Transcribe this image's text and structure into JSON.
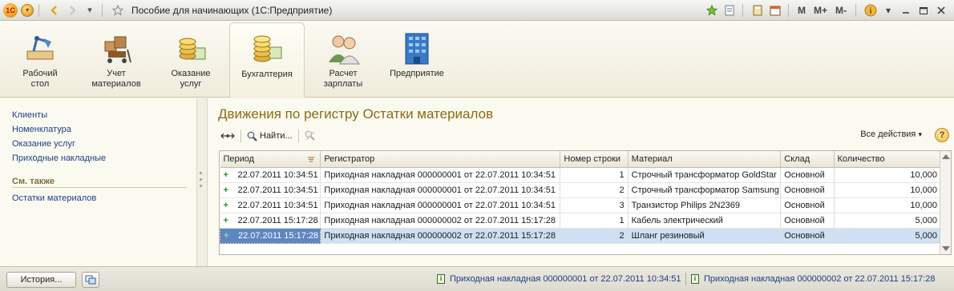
{
  "window": {
    "title": "Пособие для начинающих  (1С:Предприятие)",
    "logo": "1C",
    "right_buttons": [
      "M",
      "M+",
      "M-"
    ]
  },
  "sections": [
    {
      "label": "Рабочий\nстол",
      "icon": "desk-lamp-icon"
    },
    {
      "label": "Учет\nматериалов",
      "icon": "boxes-cart-icon"
    },
    {
      "label": "Оказание\nуслуг",
      "icon": "coins-icon"
    },
    {
      "label": "Бухгалтерия",
      "icon": "coins-stack-icon",
      "active": true
    },
    {
      "label": "Расчет\nзарплаты",
      "icon": "people-icon"
    },
    {
      "label": "Предприятие",
      "icon": "building-icon"
    }
  ],
  "left_nav": {
    "links": [
      "Клиенты",
      "Номенклатура",
      "Оказание услуг",
      "Приходные накладные"
    ],
    "see_also_title": "См. также",
    "see_also": [
      "Остатки материалов"
    ]
  },
  "form": {
    "title": "Движения по регистру Остатки материалов",
    "toolbar": {
      "find_label": "Найти...",
      "all_actions_label": "Все действия",
      "help_label": "?"
    },
    "columns": [
      "Период",
      "Регистратор",
      "Номер строки",
      "Материал",
      "Склад",
      "Количество"
    ],
    "rows": [
      {
        "period": "22.07.2011 10:34:51",
        "registrar": "Приходная накладная 000000001 от 22.07.2011 10:34:51",
        "line": "1",
        "material": "Строчный трансформатор GoldStar",
        "warehouse": "Основной",
        "qty": "10,000"
      },
      {
        "period": "22.07.2011 10:34:51",
        "registrar": "Приходная накладная 000000001 от 22.07.2011 10:34:51",
        "line": "2",
        "material": "Строчный трансформатор Samsung",
        "warehouse": "Основной",
        "qty": "10,000"
      },
      {
        "period": "22.07.2011 10:34:51",
        "registrar": "Приходная накладная 000000001 от 22.07.2011 10:34:51",
        "line": "3",
        "material": "Транзистор Philips 2N2369",
        "warehouse": "Основной",
        "qty": "10,000"
      },
      {
        "period": "22.07.2011 15:17:28",
        "registrar": "Приходная накладная 000000002 от 22.07.2011 15:17:28",
        "line": "1",
        "material": "Кабель электрический",
        "warehouse": "Основной",
        "qty": "5,000"
      },
      {
        "period": "22.07.2011 15:17:28",
        "registrar": "Приходная накладная 000000002 от 22.07.2011 15:17:28",
        "line": "2",
        "material": "Шланг резиновый",
        "warehouse": "Основной",
        "qty": "5,000",
        "selected": true
      }
    ]
  },
  "bottom": {
    "history_label": "История...",
    "open_windows": [
      "Приходная накладная 000000001 от 22.07.2011 10:34:51",
      "Приходная накладная 000000002 от 22.07.2011 15:17:28"
    ]
  },
  "colors": {
    "title_accent": "#8a6a12",
    "link": "#1d3e86",
    "selection": "#cfe0f3",
    "current_cell": "#5d86c2"
  }
}
